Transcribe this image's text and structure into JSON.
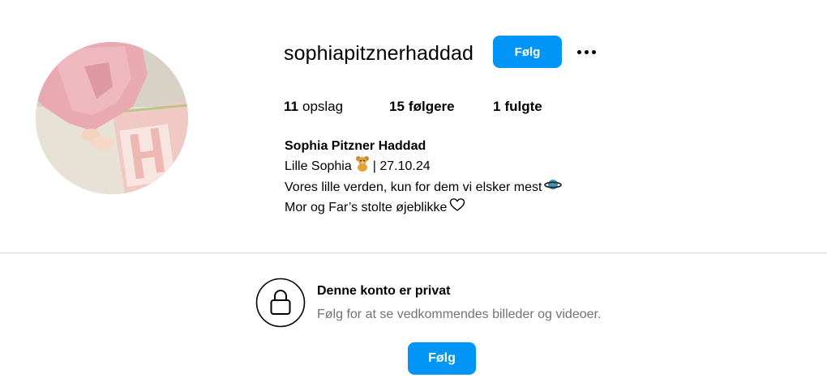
{
  "profile": {
    "username": "sophiapitznerhaddad",
    "follow_label": "Følg",
    "more_icon": "more-horizontal-icon",
    "avatar_alt": "profile picture"
  },
  "stats": {
    "posts_count": "11",
    "posts_label": "opslag",
    "followers_count": "15",
    "followers_label": "følgere",
    "following_count": "1",
    "following_label": "fulgte"
  },
  "bio": {
    "name": "Sophia Pitzner Haddad",
    "line1_a": "Lille Sophia",
    "line1_b": "| 27.10.24",
    "line2": "Vores lille verden, kun for dem vi elsker mest",
    "line3": "Mor og Far’s stolte øjeblikke"
  },
  "private": {
    "title": "Denne konto er privat",
    "subtitle": "Følg for at se vedkommendes billeder og videoer.",
    "follow_label": "Følg",
    "icon": "lock-icon"
  },
  "colors": {
    "accent": "#0095f6",
    "divider": "#dbdbdb",
    "muted_text": "#737373"
  }
}
